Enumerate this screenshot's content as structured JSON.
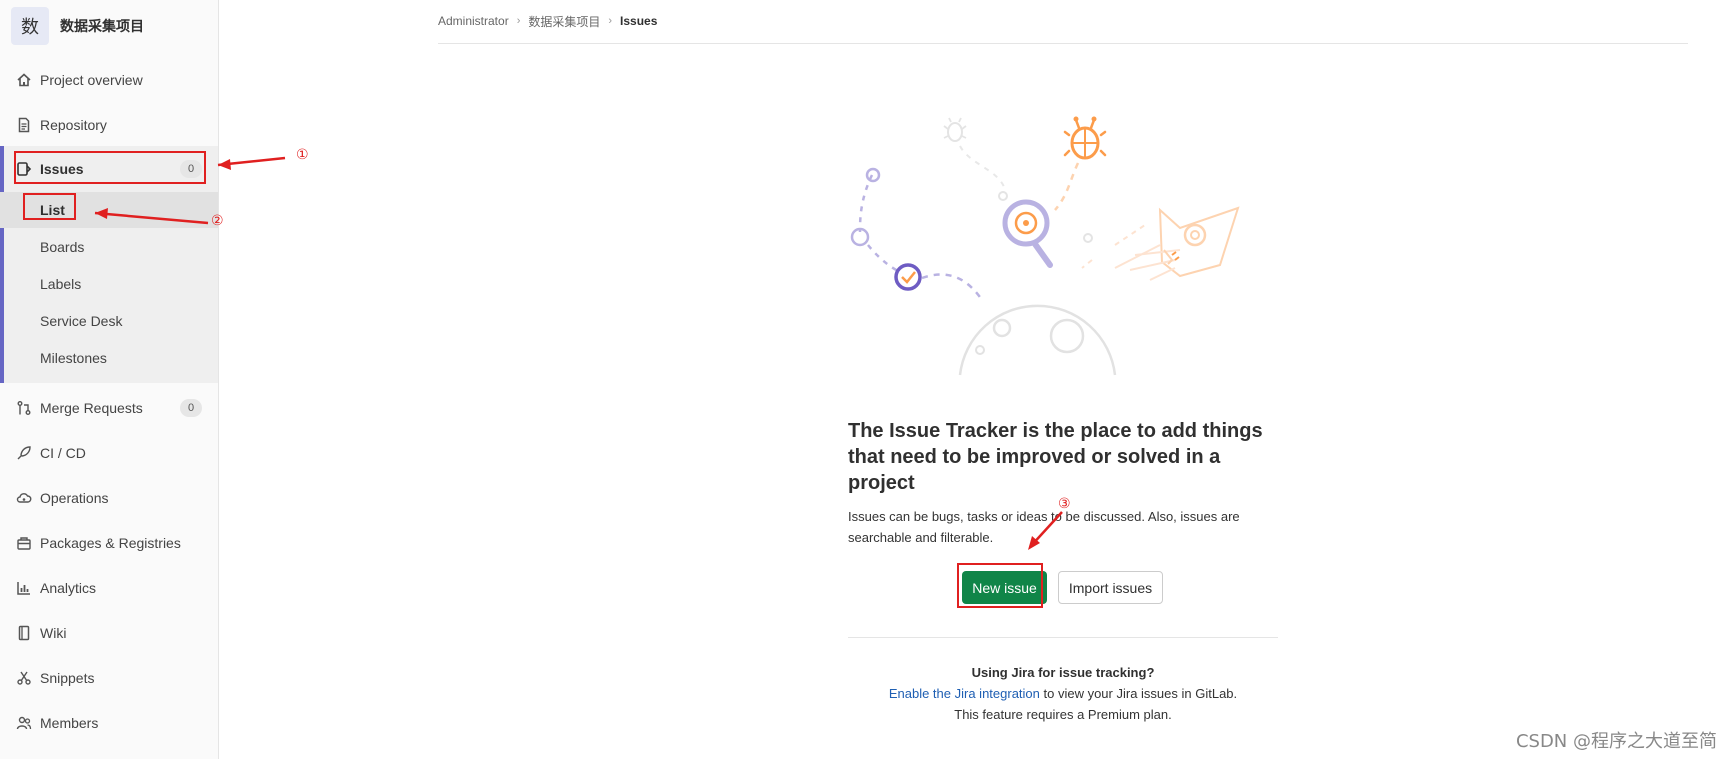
{
  "project": {
    "avatar_letter": "数",
    "name": "数据采集项目"
  },
  "sidebar": {
    "items": [
      {
        "label": "Project overview",
        "icon": "home-icon"
      },
      {
        "label": "Repository",
        "icon": "document-icon"
      },
      {
        "label": "Issues",
        "icon": "issues-icon",
        "badge": "0"
      },
      {
        "label": "Merge Requests",
        "icon": "merge-request-icon",
        "badge": "0"
      },
      {
        "label": "CI / CD",
        "icon": "rocket-icon"
      },
      {
        "label": "Operations",
        "icon": "cloud-gear-icon"
      },
      {
        "label": "Packages & Registries",
        "icon": "package-icon"
      },
      {
        "label": "Analytics",
        "icon": "chart-icon"
      },
      {
        "label": "Wiki",
        "icon": "book-icon"
      },
      {
        "label": "Snippets",
        "icon": "scissors-icon"
      },
      {
        "label": "Members",
        "icon": "users-icon"
      }
    ],
    "issues_sub": [
      "List",
      "Boards",
      "Labels",
      "Service Desk",
      "Milestones"
    ]
  },
  "breadcrumb": [
    "Administrator",
    "数据采集项目",
    "Issues"
  ],
  "empty_state": {
    "title": "The Issue Tracker is the place to add things that need to be improved or solved in a project",
    "description": "Issues can be bugs, tasks or ideas to be discussed. Also, issues are searchable and filterable.",
    "new_issue_label": "New issue",
    "import_label": "Import issues"
  },
  "jira": {
    "title": "Using Jira for issue tracking?",
    "link": "Enable the Jira integration",
    "rest": " to view your Jira issues in GitLab.",
    "note": "This feature requires a Premium plan."
  },
  "annotations": [
    "①",
    "②",
    "③"
  ],
  "watermark": "CSDN @程序之大道至简",
  "colors": {
    "accent": "#6666c4",
    "primary_button": "#108548",
    "annotation": "#e02020",
    "link": "#1f5fb3"
  }
}
